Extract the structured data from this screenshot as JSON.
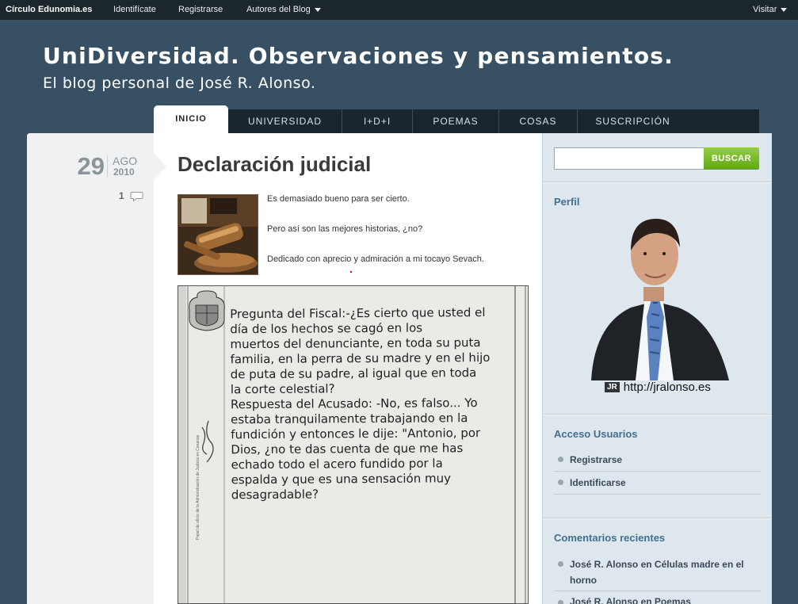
{
  "topbar": {
    "brand": "Círculo Edunomia.es",
    "links": [
      "Identifícate",
      "Registrarse",
      "Autores del Blog"
    ],
    "visitor": "Visitar"
  },
  "header": {
    "title": "UniDiversidad. Observaciones y pensamientos.",
    "subtitle": "El blog personal de José R. Alonso."
  },
  "nav": {
    "tabs": [
      "INICIO",
      "UNIVERSIDAD",
      "I+D+I",
      "POEMAS",
      "COSAS",
      "SUSCRIPCIÓN"
    ],
    "active": "INICIO"
  },
  "post": {
    "day": "29",
    "month": "AGO",
    "year": "2010",
    "comments": "1",
    "title": "Declaración judicial",
    "paragraphs": [
      "Es demasiado bueno para ser cierto.",
      "Pero así son las mejores historias, ¿no?",
      "Dedicado con aprecio y admiración a mi tocayo Sevach."
    ],
    "image_lines": [
      "Pregunta del Fiscal:-¿Es cierto que usted el",
      "día de los hechos se cagó en los",
      "muertos del denunciante, en toda su puta",
      "familia, en la perra de su madre y en el hijo",
      "de puta de su padre, al igual que en toda",
      "la corte celestial?",
      "Respuesta del Acusado: -No, es falso... Yo",
      "estaba tranquilamente trabajando en la",
      "fundición y entonces le dije: \"Antonio, por",
      "Dios, ¿no te das cuenta de que me has",
      "echado todo el acero fundido por la",
      "espalda y que es una sensación muy",
      "desagradable?"
    ],
    "image_margin_text": "Papel de oficio de la Administración de Justicia en Canarias"
  },
  "sidebar": {
    "search_button": "BUSCAR",
    "profile_heading": "Perfil",
    "profile_caption": "http://jralonso.es",
    "profile_caption_mark": "JR",
    "access_heading": "Acceso Usuarios",
    "access_items": [
      "Registrarse",
      "Identificarse"
    ],
    "comments_heading": "Comentarios recientes",
    "recent_comments": [
      "José R. Alonso en Células madre en el horno",
      "José R. Alonso en Poemas"
    ]
  },
  "colors": {
    "background": "#385063",
    "topbar": "#1c262d",
    "nav": "#1a252d",
    "accent_link": "#41708f",
    "search_button": "#6fb526"
  },
  "icons": [
    "caret-down-icon",
    "comment-bubble-icon",
    "gavel-image",
    "coat-of-arms-icon",
    "signature-mark",
    "profile-photo"
  ]
}
